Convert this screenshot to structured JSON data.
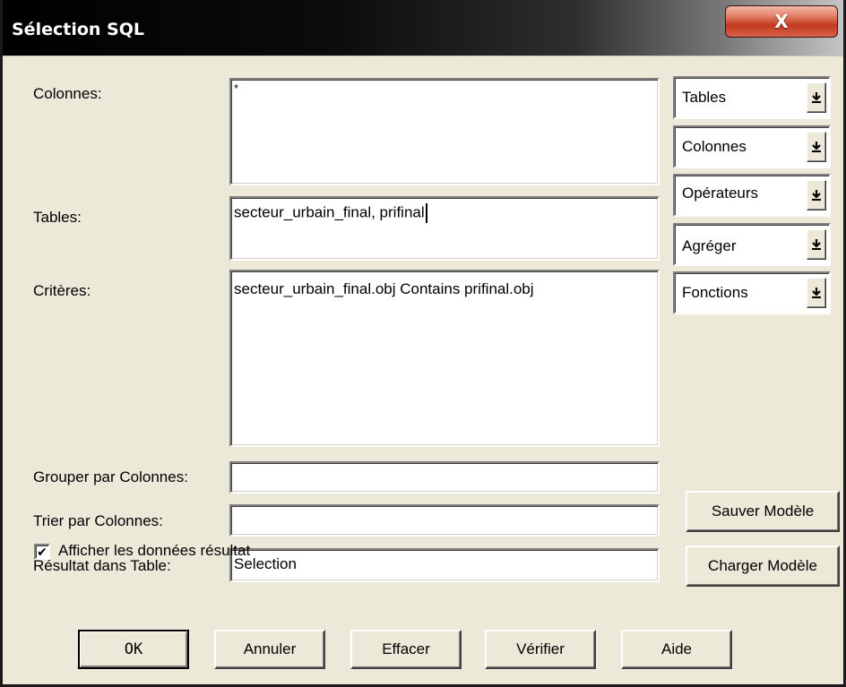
{
  "window": {
    "title": "Sélection SQL",
    "close_label": "X"
  },
  "fields": {
    "columns": {
      "label": "Colonnes:",
      "value": "*"
    },
    "tables": {
      "label": "Tables:",
      "value": "secteur_urbain_final, prifinal"
    },
    "criteria": {
      "label": "Critères:",
      "value": "secteur_urbain_final.obj Contains prifinal.obj"
    },
    "group_by": {
      "label": "Grouper par Colonnes:",
      "value": ""
    },
    "order_by": {
      "label": "Trier par Colonnes:",
      "value": ""
    },
    "result_table": {
      "label": "Résultat dans Table:",
      "value": "Selection"
    }
  },
  "dropdowns": [
    {
      "label": "Tables",
      "icon": "chevron-down-icon"
    },
    {
      "label": "Colonnes",
      "icon": "chevron-down-icon"
    },
    {
      "label": "Opérateurs",
      "icon": "chevron-down-icon"
    },
    {
      "label": "Agréger",
      "icon": "chevron-down-icon"
    },
    {
      "label": "Fonctions",
      "icon": "chevron-down-icon"
    }
  ],
  "side_buttons": {
    "save_template": "Sauver Modèle",
    "load_template": "Charger Modèle"
  },
  "checkbox": {
    "label": "Afficher les données résultat",
    "checked": true,
    "mark": "✔"
  },
  "buttons": {
    "ok": "OK",
    "cancel": "Annuler",
    "clear": "Effacer",
    "verify": "Vérifier",
    "help": "Aide"
  },
  "colors": {
    "dialog_bg": "#ece9d8",
    "titlebar_start": "#000000",
    "close_button": "#c0391f"
  }
}
